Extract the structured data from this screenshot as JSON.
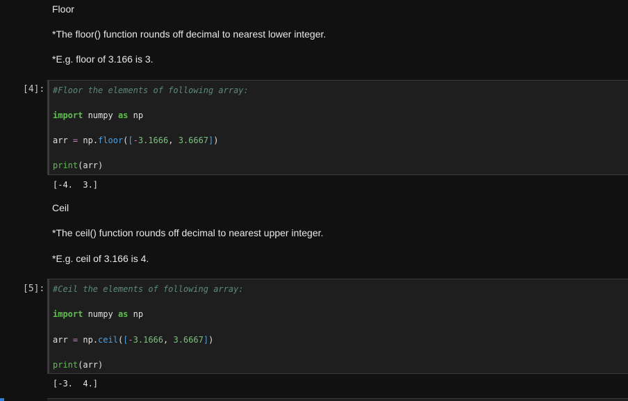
{
  "floor_section": {
    "heading": "Floor",
    "desc": "*The floor() function rounds off decimal to nearest lower integer.",
    "example": "*E.g. floor of 3.166 is 3."
  },
  "cell_floor": {
    "prompt": "[4]:",
    "comment": "#Floor the elements of following array:",
    "import_kw": "import",
    "import_mod": " numpy ",
    "as_kw": "as",
    "alias": " np",
    "assign_lhs": "arr ",
    "assign_op": "=",
    "np_prefix": " np.",
    "func": "floor",
    "open_paren": "(",
    "open_br": "[",
    "neg_op": "-",
    "val1": "3.1666",
    "comma": ", ",
    "val2": "3.6667",
    "close_br": "]",
    "close_paren": ")",
    "print_fn": "print",
    "print_arg": "(arr)",
    "output": "[-4.  3.]"
  },
  "ceil_section": {
    "heading": "Ceil",
    "desc": "*The ceil() function rounds off decimal to nearest upper integer.",
    "example": "*E.g. ceil of 3.166 is 4."
  },
  "cell_ceil": {
    "prompt": "[5]:",
    "comment": "#Ceil the elements of following array:",
    "import_kw": "import",
    "import_mod": " numpy ",
    "as_kw": "as",
    "alias": " np",
    "assign_lhs": "arr ",
    "assign_op": "=",
    "np_prefix": " np.",
    "func": "ceil",
    "open_paren": "(",
    "open_br": "[",
    "neg_op": "-",
    "val1": "3.1666",
    "comma": ", ",
    "val2": "3.6667",
    "close_br": "]",
    "close_paren": ")",
    "print_fn": "print",
    "print_arg": "(arr)",
    "output": "[-3.  4.]"
  }
}
